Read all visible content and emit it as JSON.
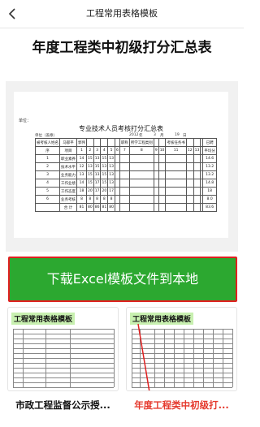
{
  "nav": {
    "title": "工程常用表格模板",
    "back_icon": "back-arrow-icon"
  },
  "page_title": "年度工程类中初级打分汇总表",
  "preview": {
    "dept_label": "单位：",
    "sheet_title": "专业技术人员考核打分汇总表",
    "meta": {
      "unit": "单位（盖章）",
      "year": "2012",
      "year_suffix": "年",
      "month": "3",
      "month_suffix": "月",
      "day": "19",
      "day_suffix": "日"
    },
    "header1": [
      "被考核人姓名",
      "马郁平",
      "郭伟",
      "",
      "",
      "",
      "",
      "",
      "职称",
      "所学工程类别",
      "",
      "",
      "考核任务书",
      "",
      "",
      "",
      "已聘"
    ],
    "header2": [
      "序",
      "项目",
      "1",
      "2",
      "3",
      "4",
      "5",
      "6",
      "7",
      "8",
      "9",
      "10",
      "11",
      "12",
      "13",
      "",
      "平均分"
    ],
    "rows": [
      [
        "1",
        "职业素养",
        "14",
        "15",
        "13",
        "15",
        "13",
        "",
        "",
        "",
        "",
        "",
        "",
        "",
        "",
        "",
        "14.6"
      ],
      [
        "2",
        "技术水平",
        "12",
        "13",
        "15",
        "13",
        "13",
        "",
        "",
        "",
        "",
        "",
        "",
        "",
        "",
        "",
        "13.2"
      ],
      [
        "3",
        "业务能力",
        "13",
        "15",
        "13",
        "15",
        "13",
        "",
        "",
        "",
        "",
        "",
        "",
        "",
        "",
        "",
        "13.2"
      ],
      [
        "4",
        "工作业绩",
        "14",
        "15",
        "17",
        "15",
        "13",
        "",
        "",
        "",
        "",
        "",
        "",
        "",
        "",
        "",
        "14.8"
      ],
      [
        "5",
        "工作态度",
        "18",
        "20",
        "17",
        "20",
        "17",
        "",
        "",
        "",
        "",
        "",
        "",
        "",
        "",
        "",
        "18"
      ],
      [
        "6",
        "业务考核",
        "8",
        "8",
        "8",
        "8",
        "8",
        "",
        "",
        "",
        "",
        "",
        "",
        "",
        "",
        "",
        "8.0"
      ],
      [
        "",
        "合  计",
        "81",
        "80",
        "86",
        "81",
        "80",
        "",
        "",
        "",
        "",
        "",
        "",
        "",
        "",
        "",
        "83.6"
      ]
    ]
  },
  "download_button": "下载Excel模板文件到本地",
  "cards": [
    {
      "badge": "工程常用表格模板",
      "label": "市政工程监督公示授...",
      "active": false
    },
    {
      "badge": "工程常用表格模板",
      "label": "年度工程类中初级打...",
      "active": true
    }
  ],
  "colors": {
    "accent_green": "#2ca830",
    "highlight_red": "#e02020",
    "badge_green": "#c8f0b0",
    "active_label": "#e53a2e"
  }
}
